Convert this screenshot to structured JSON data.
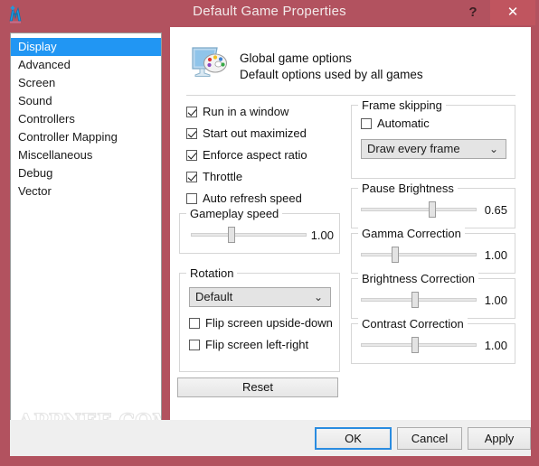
{
  "window": {
    "title": "Default Game Properties",
    "app_icon": "mame-plus-icon",
    "help_label": "?",
    "close_label": "✕",
    "accent_red": "#b2525f",
    "close_red": "#c0555f"
  },
  "sidebar": {
    "items": [
      {
        "label": "Display",
        "selected": true
      },
      {
        "label": "Advanced",
        "selected": false
      },
      {
        "label": "Screen",
        "selected": false
      },
      {
        "label": "Sound",
        "selected": false
      },
      {
        "label": "Controllers",
        "selected": false
      },
      {
        "label": "Controller Mapping",
        "selected": false
      },
      {
        "label": "Miscellaneous",
        "selected": false
      },
      {
        "label": "Debug",
        "selected": false
      },
      {
        "label": "Vector",
        "selected": false
      }
    ],
    "selected_color": "#2196f3",
    "watermark": "APPNEE.COM"
  },
  "header": {
    "icon": "monitor-palette-icon",
    "line1": "Global game options",
    "line2": "Default options used by all games"
  },
  "options": {
    "checkboxes": [
      {
        "label": "Run in a window",
        "checked": true
      },
      {
        "label": "Start out maximized",
        "checked": true
      },
      {
        "label": "Enforce aspect ratio",
        "checked": true
      },
      {
        "label": "Throttle",
        "checked": true
      },
      {
        "label": "Auto refresh speed",
        "checked": false
      }
    ]
  },
  "gameplay_speed": {
    "title": "Gameplay speed",
    "value": "1.00",
    "thumb_percent": 35
  },
  "rotation": {
    "title": "Rotation",
    "selected": "Default",
    "chevron": "⌄",
    "options": [
      "Default"
    ],
    "checkboxes": [
      {
        "label": "Flip screen upside-down",
        "checked": false
      },
      {
        "label": "Flip screen left-right",
        "checked": false
      }
    ]
  },
  "frame_skipping": {
    "title": "Frame skipping",
    "automatic": {
      "label": "Automatic",
      "checked": false
    },
    "selected": "Draw every frame",
    "chevron": "⌄",
    "options": [
      "Draw every frame"
    ]
  },
  "pause_brightness": {
    "title": "Pause Brightness",
    "value": "0.65",
    "thumb_percent": 62
  },
  "gamma_correction": {
    "title": "Gamma Correction",
    "value": "1.00",
    "thumb_percent": 30
  },
  "brightness_correction": {
    "title": "Brightness Correction",
    "value": "1.00",
    "thumb_percent": 47
  },
  "contrast_correction": {
    "title": "Contrast Correction",
    "value": "1.00",
    "thumb_percent": 47
  },
  "buttons": {
    "reset": "Reset",
    "ok": "OK",
    "cancel": "Cancel",
    "apply": "Apply"
  }
}
